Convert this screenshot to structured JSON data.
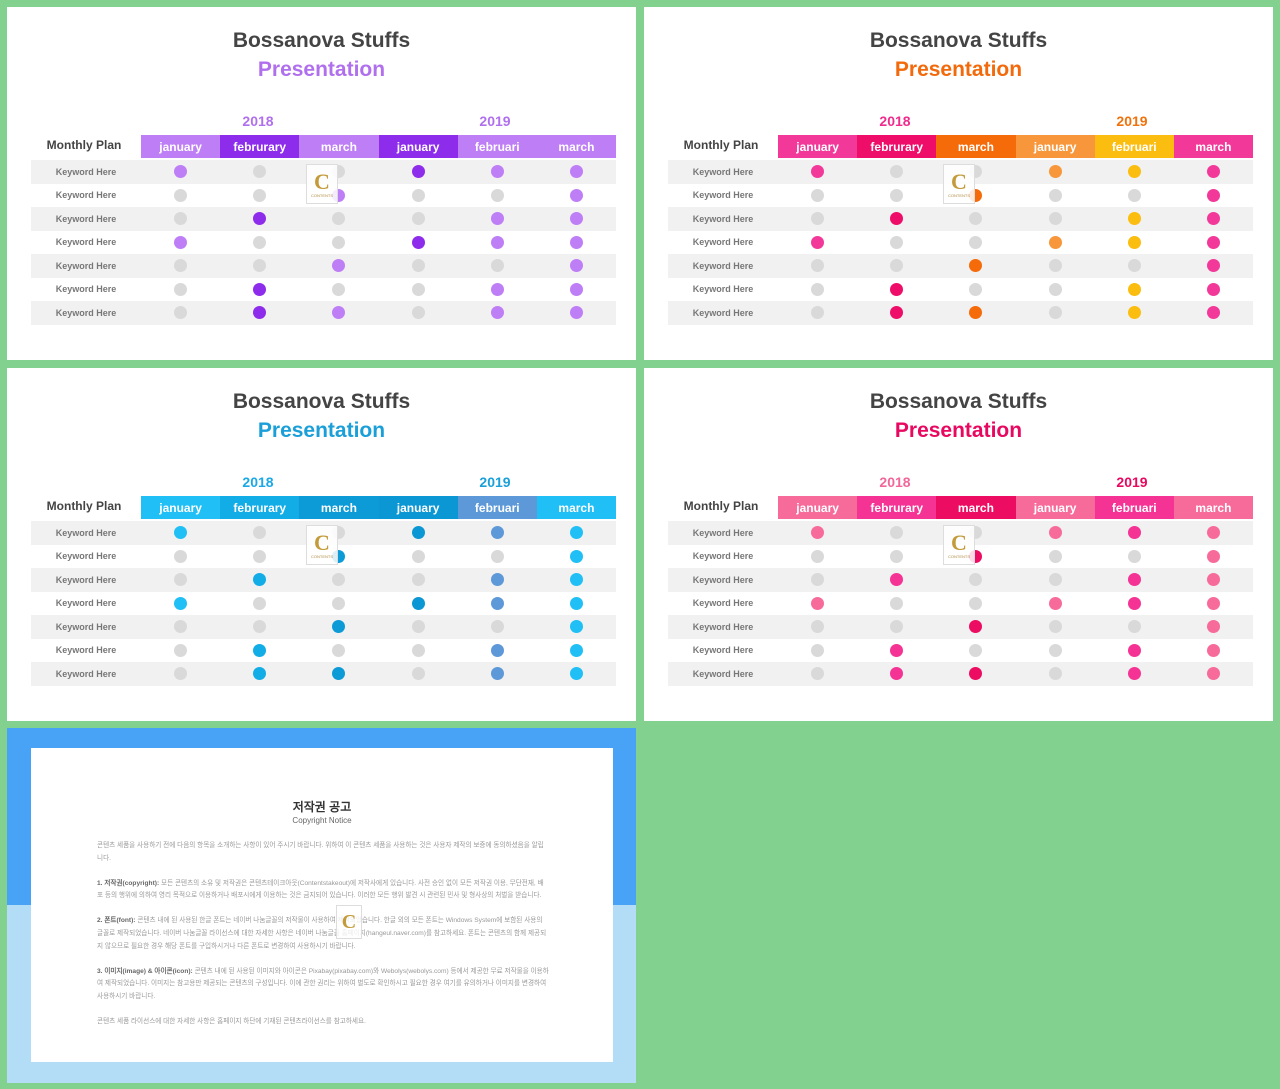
{
  "slides": [
    {
      "title": "Bossanova Stuffs",
      "subtitle": "Presentation",
      "subtitle_color": "#b070ee",
      "year_labels": [
        "2018",
        "2019"
      ],
      "year_colors": [
        "#b070ee",
        "#b070ee"
      ],
      "row_header": "Monthly Plan",
      "months": [
        "january",
        "februrary",
        "march",
        "january",
        "februari",
        "march"
      ],
      "header_colors": [
        "#be7ef6",
        "#8d2ceb",
        "#be7ef6",
        "#8d2ceb",
        "#be7ef6",
        "#be7ef6"
      ],
      "dot_colors": [
        "#be7ef6",
        "#8d2ceb",
        "#be7ef6",
        "#8d2ceb",
        "#be7ef6",
        "#be7ef6"
      ],
      "rows": [
        {
          "label": "Keyword Here",
          "active": [
            1,
            0,
            0,
            1,
            1,
            1
          ]
        },
        {
          "label": "Keyword Here",
          "active": [
            0,
            0,
            1,
            0,
            0,
            1
          ]
        },
        {
          "label": "Keyword Here",
          "active": [
            0,
            1,
            0,
            0,
            1,
            1
          ]
        },
        {
          "label": "Keyword Here",
          "active": [
            1,
            0,
            0,
            1,
            1,
            1
          ]
        },
        {
          "label": "Keyword Here",
          "active": [
            0,
            0,
            1,
            0,
            0,
            1
          ]
        },
        {
          "label": "Keyword Here",
          "active": [
            0,
            1,
            0,
            0,
            1,
            1
          ]
        },
        {
          "label": "Keyword Here",
          "active": [
            0,
            1,
            1,
            0,
            1,
            1
          ]
        }
      ]
    },
    {
      "title": "Bossanova Stuffs",
      "subtitle": "Presentation",
      "subtitle_color": "#f26a0c",
      "year_labels": [
        "2018",
        "2019"
      ],
      "year_colors": [
        "#ef2b8b",
        "#f0720d"
      ],
      "row_header": "Monthly Plan",
      "months": [
        "january",
        "februrary",
        "march",
        "january",
        "februari",
        "march"
      ],
      "header_colors": [
        "#f2399a",
        "#ee0d69",
        "#f56b0a",
        "#f7963a",
        "#fbbd0f",
        "#f2399a"
      ],
      "dot_colors": [
        "#f2399a",
        "#ee0d69",
        "#f56b0a",
        "#f7963a",
        "#fbbd0f",
        "#f2399a"
      ],
      "rows": [
        {
          "label": "Keyword Here",
          "active": [
            1,
            0,
            0,
            1,
            1,
            1
          ]
        },
        {
          "label": "Keyword Here",
          "active": [
            0,
            0,
            1,
            0,
            0,
            1
          ]
        },
        {
          "label": "Keyword Here",
          "active": [
            0,
            1,
            0,
            0,
            1,
            1
          ]
        },
        {
          "label": "Keyword Here",
          "active": [
            1,
            0,
            0,
            1,
            1,
            1
          ]
        },
        {
          "label": "Keyword Here",
          "active": [
            0,
            0,
            1,
            0,
            0,
            1
          ]
        },
        {
          "label": "Keyword Here",
          "active": [
            0,
            1,
            0,
            0,
            1,
            1
          ]
        },
        {
          "label": "Keyword Here",
          "active": [
            0,
            1,
            1,
            0,
            1,
            1
          ]
        }
      ]
    },
    {
      "title": "Bossanova Stuffs",
      "subtitle": "Presentation",
      "subtitle_color": "#1a9fd8",
      "year_labels": [
        "2018",
        "2019"
      ],
      "year_colors": [
        "#1aa8e6",
        "#1a9fd8"
      ],
      "row_header": "Monthly Plan",
      "months": [
        "january",
        "februrary",
        "march",
        "january",
        "februari",
        "march"
      ],
      "header_colors": [
        "#20bff5",
        "#12ade6",
        "#0c9bd6",
        "#0b97d3",
        "#5d99d8",
        "#20bff5"
      ],
      "dot_colors": [
        "#20bff5",
        "#12ade6",
        "#0c9bd6",
        "#0b97d3",
        "#5d99d8",
        "#20bff5"
      ],
      "rows": [
        {
          "label": "Keyword Here",
          "active": [
            1,
            0,
            0,
            1,
            1,
            1
          ]
        },
        {
          "label": "Keyword Here",
          "active": [
            0,
            0,
            1,
            0,
            0,
            1
          ]
        },
        {
          "label": "Keyword Here",
          "active": [
            0,
            1,
            0,
            0,
            1,
            1
          ]
        },
        {
          "label": "Keyword Here",
          "active": [
            1,
            0,
            0,
            1,
            1,
            1
          ]
        },
        {
          "label": "Keyword Here",
          "active": [
            0,
            0,
            1,
            0,
            0,
            1
          ]
        },
        {
          "label": "Keyword Here",
          "active": [
            0,
            1,
            0,
            0,
            1,
            1
          ]
        },
        {
          "label": "Keyword Here",
          "active": [
            0,
            1,
            1,
            0,
            1,
            1
          ]
        }
      ]
    },
    {
      "title": "Bossanova Stuffs",
      "subtitle": "Presentation",
      "subtitle_color": "#e8085f",
      "year_labels": [
        "2018",
        "2019"
      ],
      "year_colors": [
        "#f2679a",
        "#e8085f"
      ],
      "row_header": "Monthly Plan",
      "months": [
        "january",
        "februrary",
        "march",
        "january",
        "februari",
        "march"
      ],
      "header_colors": [
        "#f76b9b",
        "#f43394",
        "#ec0c62",
        "#f76b9b",
        "#f43394",
        "#f76b9b"
      ],
      "dot_colors": [
        "#f76b9b",
        "#f43394",
        "#ec0c62",
        "#f76b9b",
        "#f43394",
        "#f76b9b"
      ],
      "rows": [
        {
          "label": "Keyword Here",
          "active": [
            1,
            0,
            0,
            1,
            1,
            1
          ]
        },
        {
          "label": "Keyword Here",
          "active": [
            0,
            0,
            1,
            0,
            0,
            1
          ]
        },
        {
          "label": "Keyword Here",
          "active": [
            0,
            1,
            0,
            0,
            1,
            1
          ]
        },
        {
          "label": "Keyword Here",
          "active": [
            1,
            0,
            0,
            1,
            1,
            1
          ]
        },
        {
          "label": "Keyword Here",
          "active": [
            0,
            0,
            1,
            0,
            0,
            1
          ]
        },
        {
          "label": "Keyword Here",
          "active": [
            0,
            1,
            0,
            0,
            1,
            1
          ]
        },
        {
          "label": "Keyword Here",
          "active": [
            0,
            1,
            1,
            0,
            1,
            1
          ]
        }
      ]
    }
  ],
  "inactive_dot_color": "#d9d9d9",
  "watermark": {
    "letter": "C",
    "text": "CONTENTS"
  },
  "copyright": {
    "title": "저작권 공고",
    "subtitle": "Copyright Notice",
    "intro": "콘텐츠 세품을 사용하기 전에 다음의 항목을 소개하는 사항이 있어 주시기 바랍니다. 위하여 이 콘텐츠 세품을 사용하는 것은 사용자 제작의 보증에 동의하셨음을 알립니다.",
    "sections": [
      {
        "head": "1. 저작권(copyright):",
        "body": "모든 콘텐츠의 소유 및 저작권은 콘텐츠테이크아웃(Contentstakeout)에 저작사에게 있습니다. 사전 승인 없이 모든 저작권 이용, 무단전재, 배포 등의 행위에 의하여 영리 목적으로 이용하거나 배포시에게 이용하는 것은 금지되어 있습니다. 이러한 모든 행위 발견 시 관련된 민사 및 형사상의 처벌을 받습니다."
      },
      {
        "head": "2. 폰트(font):",
        "body": "콘텐츠 내에 된 사용된 한글 폰트는 네이버 나눔글꼴의 저작물이 사용하여 제작되었습니다. 한글 외의 모든 폰트는 Windows System에 보함된 사용의 글꼴로 제작되었습니다. 네이버 나눔글꼴 라이선스에 대한 자세한 사항은 네이버 나눔글꼴 홈페이지(hangeul.naver.com)를 참고하세요. 폰트는 콘텐츠의 함께 제공되지 않으므로 필요한 경우 해당 폰트를 구입하시거나 다른 폰트로 변경하여 사용하시기 바랍니다."
      },
      {
        "head": "3. 이미지(image) & 아이콘(icon):",
        "body": "콘텐츠 내에 된 사용된 이미지와 아이콘은 Pixabay(pixabay.com)와 Webolys(webolys.com) 등에서 제공한 무료 저작물을 이용하여 제작되었습니다. 이미지는 참고용만 제공되는 콘텐츠의 구성입니다. 이에 관한 권리는 위하여 별도로 확인하시고 필요한 경우 여기를 유의하거나 이미지를 변경하여 사용하시기 바랍니다."
      }
    ],
    "footer": "콘텐츠 세품 라이선스에 대한 자세한 사항은 홈페이지 하단에 기재된 콘텐츠라이선스를 참고하세요."
  }
}
